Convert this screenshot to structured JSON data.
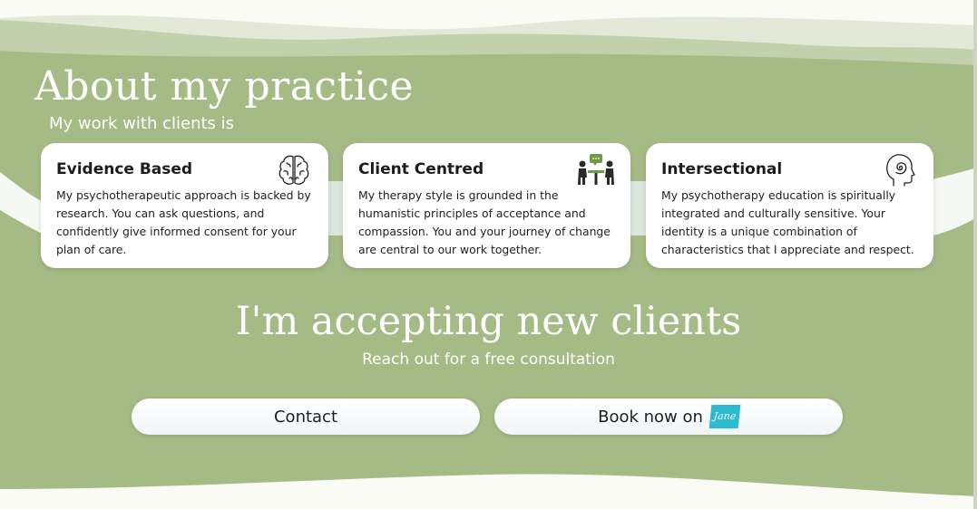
{
  "about": {
    "title": "About my practice",
    "subtitle": "My work with clients is"
  },
  "cards": [
    {
      "title": "Evidence Based",
      "body": "My psychotherapeutic approach is backed by research. You can ask questions, and confidently give informed consent for your plan of care.",
      "icon": "brain-icon"
    },
    {
      "title": "Client Centred",
      "body": "My therapy style is grounded in the humanistic principles of acceptance and compassion. You and your journey of change are central to our work together.",
      "icon": "conversation-icon"
    },
    {
      "title": "Intersectional",
      "body": "My psychotherapy education is spiritually integrated and culturally sensitive. Your identity is a unique combination of characteristics that I appreciate and respect.",
      "icon": "head-spiral-icon"
    }
  ],
  "cta": {
    "title": "I'm accepting new clients",
    "subtitle": "Reach out for a free consultation",
    "contact_label": "Contact",
    "book_label": "Book now on",
    "book_logo_text": "Jane"
  },
  "colors": {
    "section_green": "#a5bb86",
    "wave_light": "#e3e9d6",
    "wave_mid": "#c2d0ab",
    "card_bg": "#ffffff",
    "accent_green": "#6d9a4a",
    "jane_teal": "#2cbad0"
  }
}
